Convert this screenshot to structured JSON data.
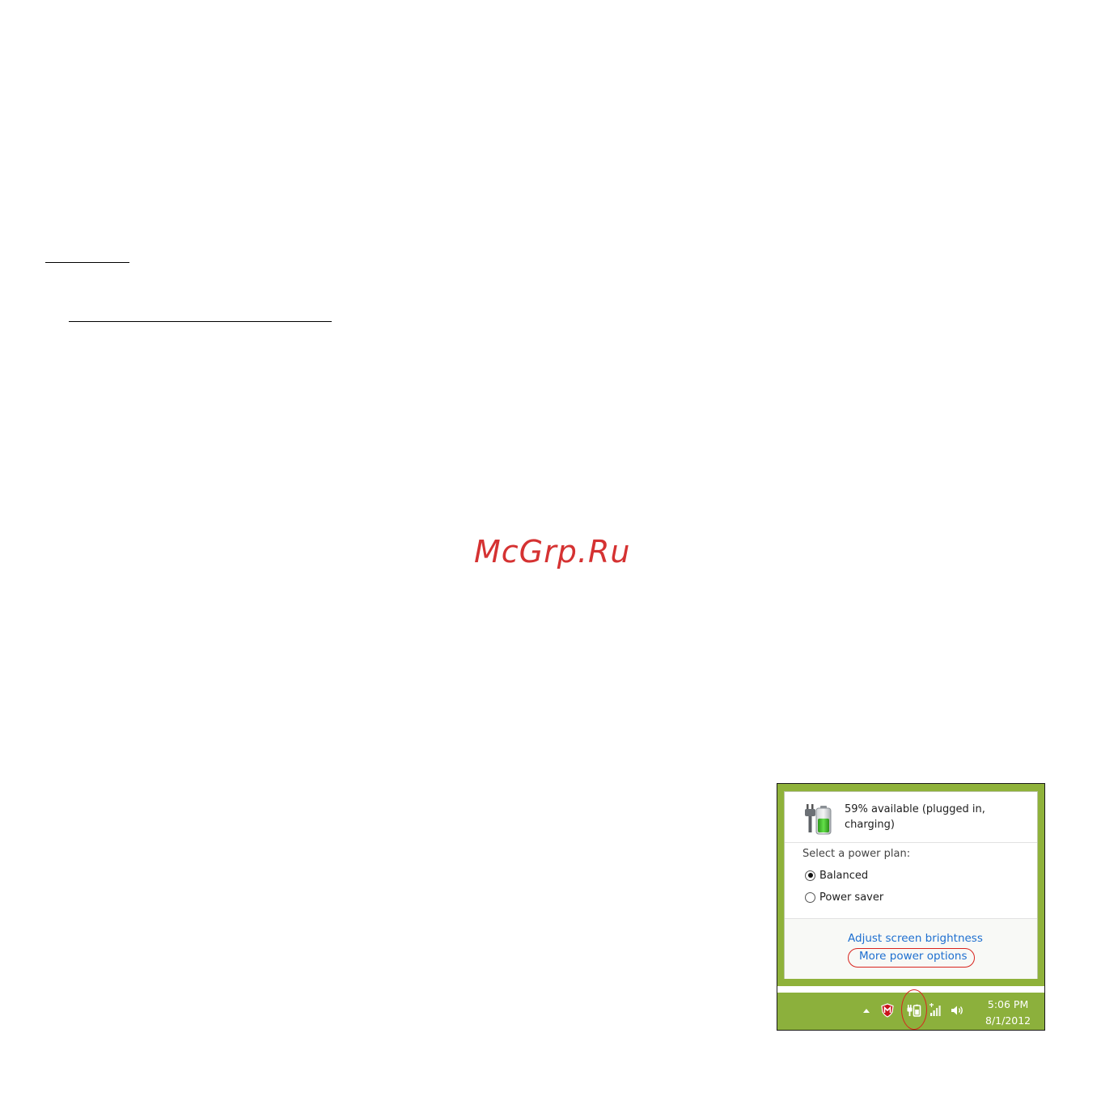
{
  "watermark": "McGrp.Ru",
  "flyout": {
    "battery_status": "59% available (plugged in, charging)",
    "battery_level": 0.59,
    "plan_label": "Select a power plan:",
    "plans": [
      {
        "label": "Balanced",
        "selected": true
      },
      {
        "label": "Power saver",
        "selected": false
      }
    ],
    "links": {
      "brightness": "Adjust screen brightness",
      "more_options": "More power options"
    }
  },
  "taskbar": {
    "time": "5:06 PM",
    "date": "8/1/2012",
    "icons": [
      "show-hidden-icons-arrow",
      "mcafee-shield-icon",
      "power-battery-icon",
      "network-signal-icon",
      "volume-speaker-icon"
    ]
  },
  "colors": {
    "taskbar_green": "#8cb03c",
    "link_blue": "#1e6fd0",
    "highlight_red": "#d8241e",
    "watermark_red": "#d53232"
  }
}
